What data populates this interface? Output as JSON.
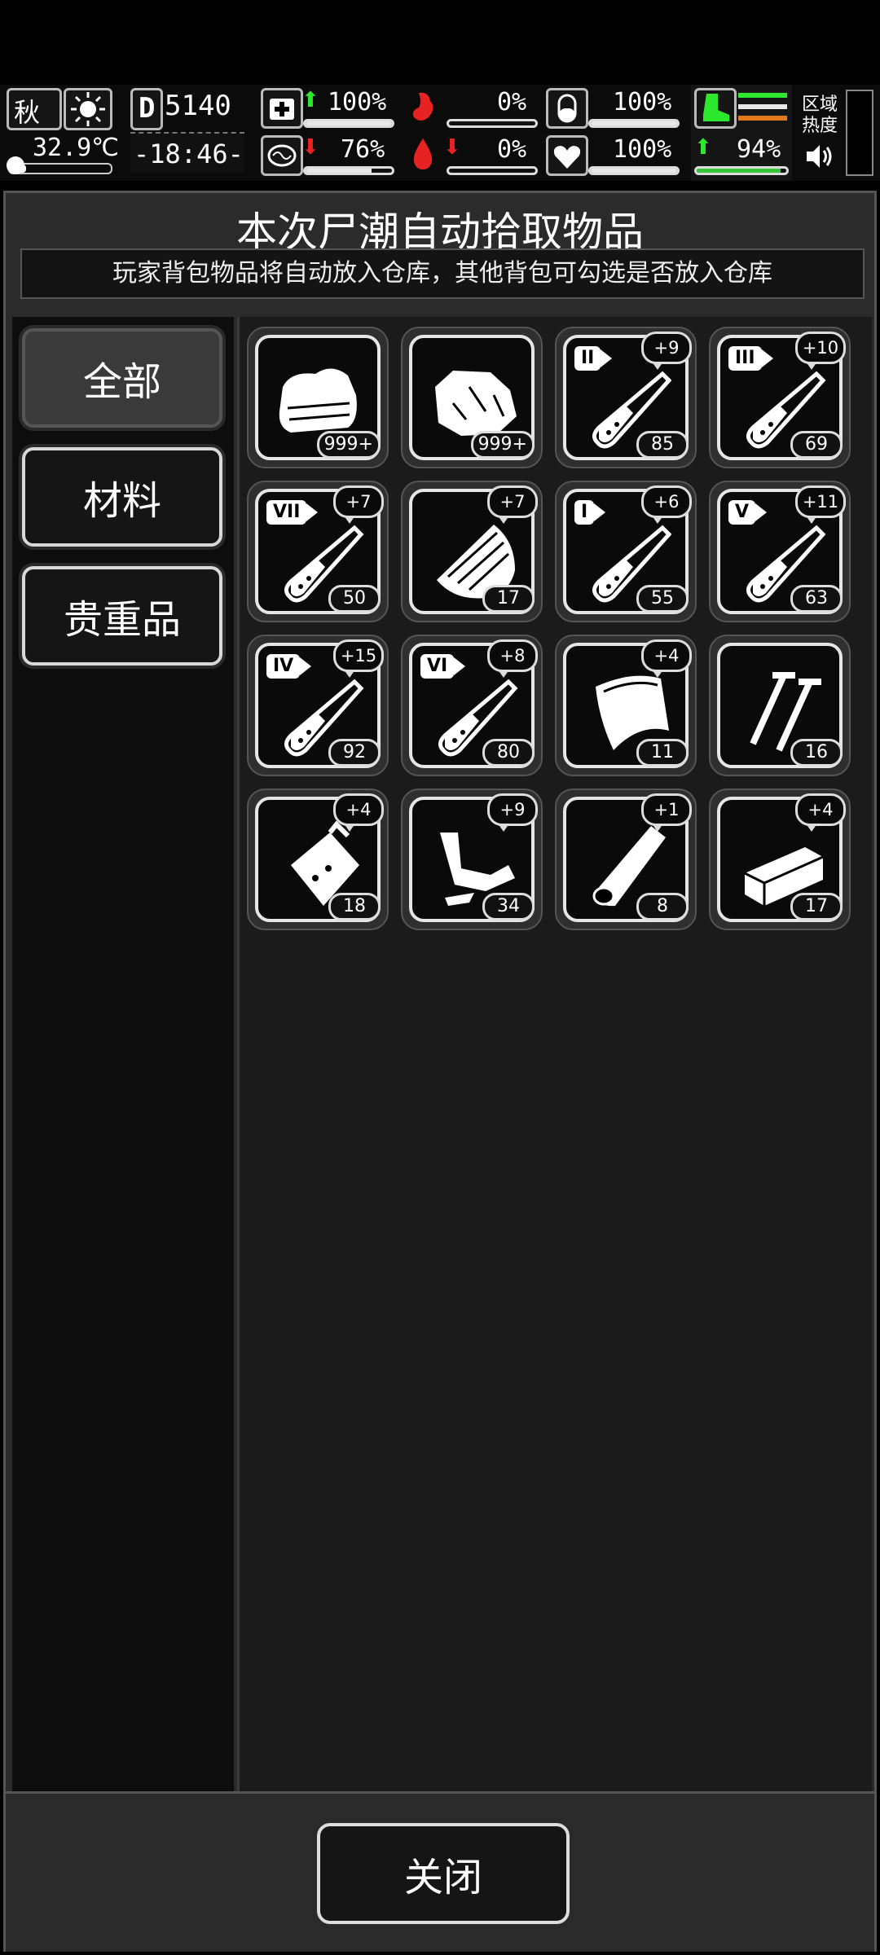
{
  "status": {
    "season": "秋",
    "temperature": "32.9℃",
    "day": "5140",
    "time": "-18:46-",
    "medical_pct": "100%",
    "stomach_pct": "0%",
    "pill_pct": "100%",
    "brain_pct": "76%",
    "blood_pct": "0%",
    "heart_pct": "100%",
    "stamina_pct": "94%",
    "zone_heat_label": "区域热度",
    "medical_level": 1.0,
    "stomach_level": 0.0,
    "pill_level": 1.0,
    "brain_level": 0.76,
    "blood_level": 0.0,
    "heart_level": 1.0,
    "stamina_level": 0.94
  },
  "dialog": {
    "title": "本次尸潮自动拾取物品",
    "notice": "玩家背包物品将自动放入仓库，其他背包可勾选是否放入仓库",
    "close_label": "关闭"
  },
  "tabs": [
    {
      "label": "全部",
      "active": true
    },
    {
      "label": "材料",
      "active": false
    },
    {
      "label": "贵重品",
      "active": false
    }
  ],
  "items": [
    {
      "icon": "cloth-icon",
      "count": "999+",
      "bonus": "",
      "roman": ""
    },
    {
      "icon": "rock-icon",
      "count": "999+",
      "bonus": "",
      "roman": ""
    },
    {
      "icon": "test-tube-icon",
      "count": "85",
      "bonus": "+9",
      "roman": "II"
    },
    {
      "icon": "test-tube-icon",
      "count": "69",
      "bonus": "+10",
      "roman": "III"
    },
    {
      "icon": "test-tube-icon",
      "count": "50",
      "bonus": "+7",
      "roman": "VII"
    },
    {
      "icon": "wood-log-icon",
      "count": "17",
      "bonus": "+7",
      "roman": ""
    },
    {
      "icon": "test-tube-icon",
      "count": "55",
      "bonus": "+6",
      "roman": "I"
    },
    {
      "icon": "test-tube-icon",
      "count": "63",
      "bonus": "+11",
      "roman": "V"
    },
    {
      "icon": "test-tube-icon",
      "count": "92",
      "bonus": "+15",
      "roman": "IV"
    },
    {
      "icon": "test-tube-icon",
      "count": "80",
      "bonus": "+8",
      "roman": "VI"
    },
    {
      "icon": "leather-sheet-icon",
      "count": "11",
      "bonus": "+4",
      "roman": ""
    },
    {
      "icon": "nails-icon",
      "count": "16",
      "bonus": "",
      "roman": ""
    },
    {
      "icon": "plastic-bag-icon",
      "count": "18",
      "bonus": "+4",
      "roman": ""
    },
    {
      "icon": "scrap-parts-icon",
      "count": "34",
      "bonus": "+9",
      "roman": ""
    },
    {
      "icon": "wood-plank-icon",
      "count": "8",
      "bonus": "+1",
      "roman": ""
    },
    {
      "icon": "brick-icon",
      "count": "17",
      "bonus": "+4",
      "roman": ""
    }
  ],
  "colors": {
    "up_arrow": "#2ee82e",
    "down_arrow": "#e62222",
    "stamina_bar": "#36c736",
    "boot_icon": "#2ee82e",
    "stripe_orange": "#e07a1a"
  }
}
